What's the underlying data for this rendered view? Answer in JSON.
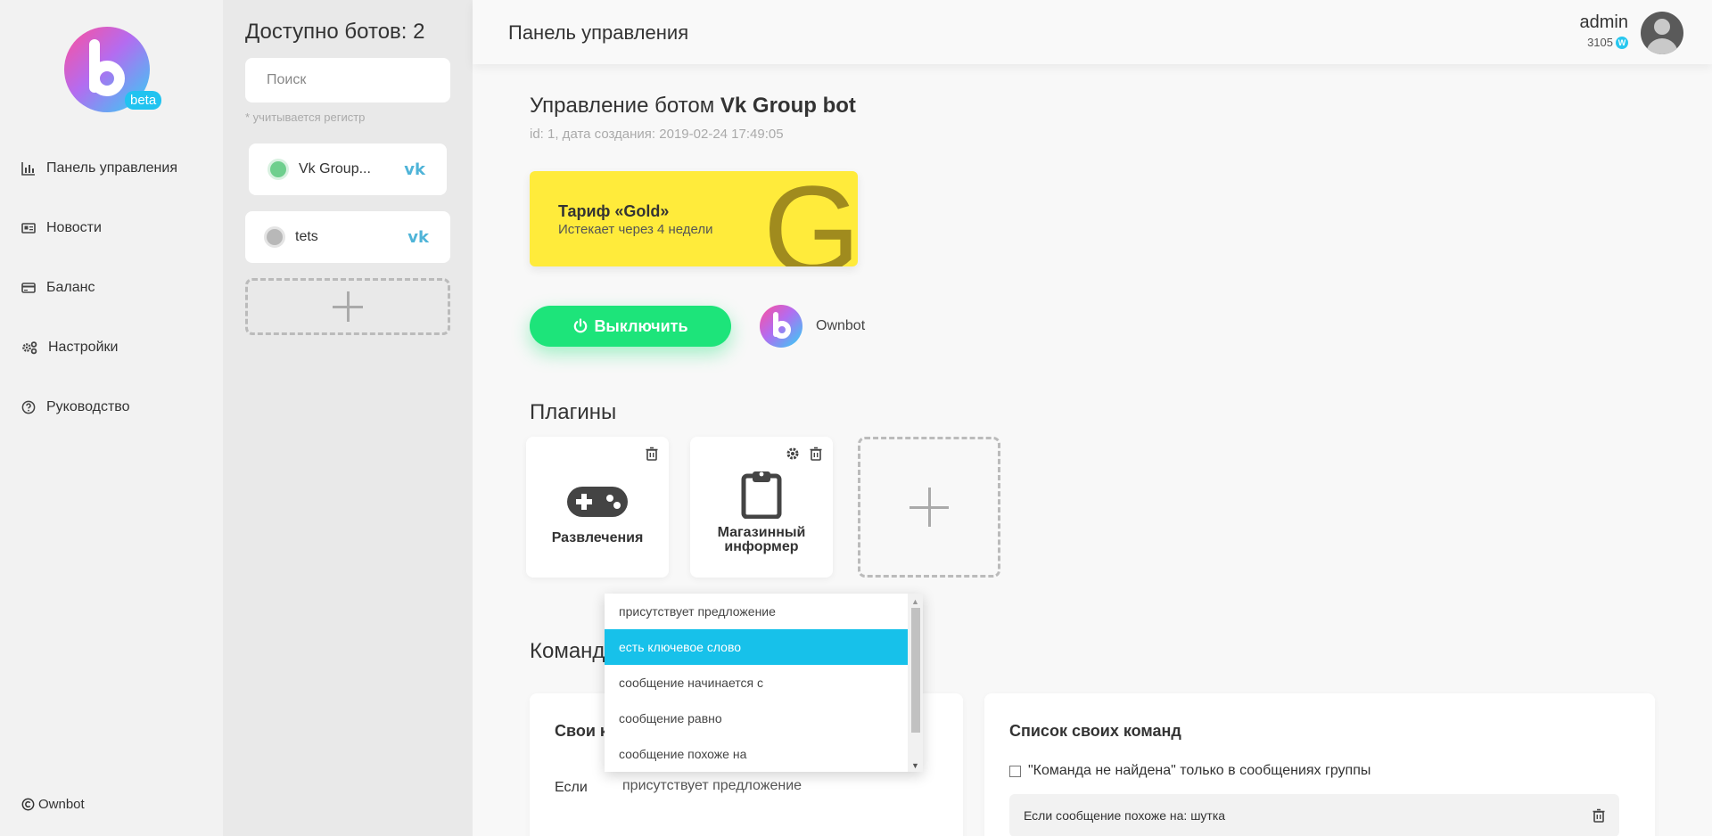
{
  "sidebar": {
    "logo_badge": "beta",
    "items": [
      {
        "label": "Панель управления",
        "icon": "chart-icon"
      },
      {
        "label": "Новости",
        "icon": "newspaper-icon"
      },
      {
        "label": "Баланс",
        "icon": "credit-card-icon"
      },
      {
        "label": "Настройки",
        "icon": "gears-icon"
      },
      {
        "label": "Руководство",
        "icon": "question-circle-icon"
      }
    ],
    "copyright": "Ownbot"
  },
  "bots": {
    "title": "Доступно ботов: 2",
    "search_placeholder": "Поиск",
    "hint": "* учитывается регистр",
    "items": [
      {
        "name": "Vk Group...",
        "status_color": "#6fcf8e",
        "platform": "vk-icon"
      },
      {
        "name": "tets",
        "status_color": "#b8b8b8",
        "platform": "vk-icon"
      }
    ]
  },
  "header": {
    "title": "Панель управления",
    "user": "admin",
    "balance": "3105",
    "coin": "W"
  },
  "bot": {
    "title_prefix": "Управление ботом ",
    "title_name": "Vk Group bot",
    "meta": "id: 1, дата создания: 2019-02-24 17:49:05",
    "tariff_name": "Тариф «Gold»",
    "tariff_expires": "Истекает через 4 недели",
    "tariff_letter": "G",
    "power_button": "Выключить",
    "engine_label": "Ownbot"
  },
  "plugins": {
    "title": "Плагины",
    "items": [
      {
        "label": "Развлечения",
        "icon": "gamepad-icon"
      },
      {
        "label": "Магазинный информер",
        "icon": "clipboard-icon"
      }
    ]
  },
  "commands": {
    "title_visible": "Команд",
    "own_card_title_visible": "Свои к",
    "condition_label": "Если",
    "condition_value": "присутствует предложение",
    "dropdown_options": [
      "присутствует предложение",
      "есть ключевое слово",
      "сообщение начинается с",
      "сообщение равно",
      "сообщение похоже на"
    ],
    "dropdown_selected_index": 1,
    "list_title": "Список своих команд",
    "checkbox_label": "\"Команда не найдена\" только в сообщениях группы",
    "list_items": [
      "Если сообщение похоже на: шутка"
    ]
  },
  "colors": {
    "accent_green": "#1de47a",
    "accent_blue": "#17c1ea",
    "tariff_yellow": "#ffeb3b"
  }
}
